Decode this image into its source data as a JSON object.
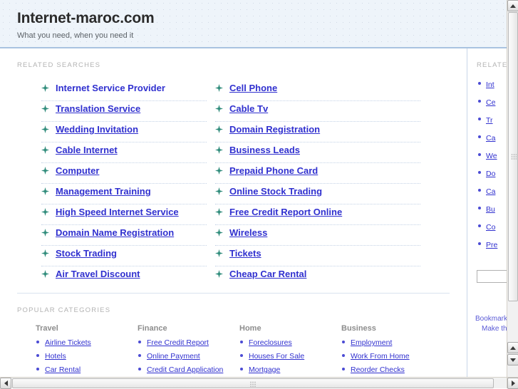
{
  "header": {
    "title": "Internet-maroc.com",
    "tagline": "What you need, when you need it"
  },
  "main": {
    "related_label": "RELATED SEARCHES",
    "related_left": [
      "Internet Service Provider",
      "Translation Service",
      "Wedding Invitation",
      "Cable Internet",
      "Computer",
      "Management Training",
      "High Speed Internet Service",
      "Domain Name Registration",
      "Stock Trading",
      "Air Travel Discount"
    ],
    "related_right": [
      "Cell Phone",
      "Cable Tv",
      "Domain Registration",
      "Business Leads",
      "Prepaid Phone Card",
      "Online Stock Trading",
      "Free Credit Report Online",
      "Wireless",
      "Tickets",
      "Cheap Car Rental"
    ],
    "popular_label": "POPULAR CATEGORIES",
    "categories": [
      {
        "title": "Travel",
        "items": [
          "Airline Tickets",
          "Hotels",
          "Car Rental"
        ]
      },
      {
        "title": "Finance",
        "items": [
          "Free Credit Report",
          "Online Payment",
          "Credit Card Application"
        ]
      },
      {
        "title": "Home",
        "items": [
          "Foreclosures",
          "Houses For Sale",
          "Mortgage"
        ]
      },
      {
        "title": "Business",
        "items": [
          "Employment",
          "Work From Home",
          "Reorder Checks"
        ]
      }
    ]
  },
  "sidebar": {
    "related_label": "RELATED",
    "items": [
      "Int",
      "Ce",
      "Tr",
      "Ca",
      "We",
      "Do",
      "Ca",
      "Bu",
      "Co",
      "Pre"
    ],
    "search_value": "",
    "search_placeholder": "",
    "footer": {
      "bookmark": "Bookmark",
      "make_this": "Make thi"
    }
  },
  "colors": {
    "link": "#3030cf",
    "header_bg": "#eef4fa",
    "header_border": "#a9c3e0",
    "bullet_star": "#2e8b7a",
    "label_gray": "#b3b3b3"
  }
}
